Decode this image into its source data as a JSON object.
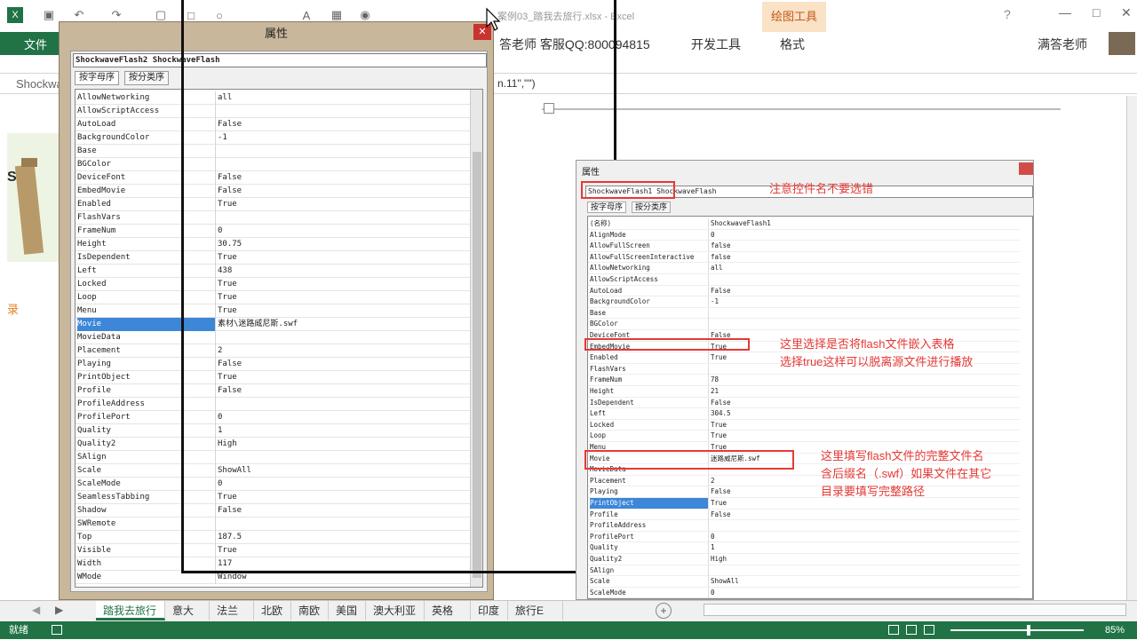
{
  "window": {
    "title": "案例03_踏我去旅行.xlsx - Excel",
    "user": "满答老师",
    "draw_tools": "绘图工具",
    "help": "?"
  },
  "ribbon": {
    "file_tab": "文件",
    "qq_label": "答老师 客服QQ:800094815",
    "dev_tab": "开发工具",
    "format_tab": "格式"
  },
  "formula_bar": {
    "name_box": "Shockwa",
    "formula_text": "n.11\",\"\")"
  },
  "sheet_left_note": "录",
  "dialog_left": {
    "title": "属性",
    "combo": "ShockwaveFlash2 ShockwaveFlash",
    "tab_alpha": "按字母序",
    "tab_cat": "按分类序",
    "rows": [
      {
        "name": "AllowNetworking",
        "value": "all"
      },
      {
        "name": "AllowScriptAccess",
        "value": ""
      },
      {
        "name": "AutoLoad",
        "value": "False"
      },
      {
        "name": "BackgroundColor",
        "value": "-1"
      },
      {
        "name": "Base",
        "value": ""
      },
      {
        "name": "BGColor",
        "value": ""
      },
      {
        "name": "DeviceFont",
        "value": "False"
      },
      {
        "name": "EmbedMovie",
        "value": "False"
      },
      {
        "name": "Enabled",
        "value": "True"
      },
      {
        "name": "FlashVars",
        "value": ""
      },
      {
        "name": "FrameNum",
        "value": "0"
      },
      {
        "name": "Height",
        "value": "30.75"
      },
      {
        "name": "IsDependent",
        "value": "True"
      },
      {
        "name": "Left",
        "value": "438"
      },
      {
        "name": "Locked",
        "value": "True"
      },
      {
        "name": "Loop",
        "value": "True"
      },
      {
        "name": "Menu",
        "value": "True"
      },
      {
        "name": "Movie",
        "value": "素材\\迷路威尼斯.swf"
      },
      {
        "name": "MovieData",
        "value": ""
      },
      {
        "name": "Placement",
        "value": "2"
      },
      {
        "name": "Playing",
        "value": "False"
      },
      {
        "name": "PrintObject",
        "value": "True"
      },
      {
        "name": "Profile",
        "value": "False"
      },
      {
        "name": "ProfileAddress",
        "value": ""
      },
      {
        "name": "ProfilePort",
        "value": "0"
      },
      {
        "name": "Quality",
        "value": "1"
      },
      {
        "name": "Quality2",
        "value": "High"
      },
      {
        "name": "SAlign",
        "value": ""
      },
      {
        "name": "Scale",
        "value": "ShowAll"
      },
      {
        "name": "ScaleMode",
        "value": "0"
      },
      {
        "name": "SeamlessTabbing",
        "value": "True"
      },
      {
        "name": "Shadow",
        "value": "False"
      },
      {
        "name": "SWRemote",
        "value": ""
      },
      {
        "name": "Top",
        "value": "187.5"
      },
      {
        "name": "Visible",
        "value": "True"
      },
      {
        "name": "Width",
        "value": "117"
      },
      {
        "name": "WMode",
        "value": "Window"
      }
    ]
  },
  "dialog_right": {
    "title": "属性",
    "combo": "ShockwaveFlash1 ShockwaveFlash",
    "tab_alpha": "按字母序",
    "tab_cat": "按分类序",
    "rows": [
      {
        "name": "(名称)",
        "value": "ShockwaveFlash1"
      },
      {
        "name": "AlignMode",
        "value": "0"
      },
      {
        "name": "AllowFullScreen",
        "value": "false"
      },
      {
        "name": "AllowFullScreenInteractive",
        "value": "false"
      },
      {
        "name": "AllowNetworking",
        "value": "all"
      },
      {
        "name": "AllowScriptAccess",
        "value": ""
      },
      {
        "name": "AutoLoad",
        "value": "False"
      },
      {
        "name": "BackgroundColor",
        "value": "-1"
      },
      {
        "name": "Base",
        "value": ""
      },
      {
        "name": "BGColor",
        "value": ""
      },
      {
        "name": "DeviceFont",
        "value": "False"
      },
      {
        "name": "EmbedMovie",
        "value": "True"
      },
      {
        "name": "Enabled",
        "value": "True"
      },
      {
        "name": "FlashVars",
        "value": ""
      },
      {
        "name": "FrameNum",
        "value": "78"
      },
      {
        "name": "Height",
        "value": "21"
      },
      {
        "name": "IsDependent",
        "value": "False"
      },
      {
        "name": "Left",
        "value": "304.5"
      },
      {
        "name": "Locked",
        "value": "True"
      },
      {
        "name": "Loop",
        "value": "True"
      },
      {
        "name": "Menu",
        "value": "True"
      },
      {
        "name": "Movie",
        "value": "迷路威尼斯.swf"
      },
      {
        "name": "MovieData",
        "value": ""
      },
      {
        "name": "Placement",
        "value": "2"
      },
      {
        "name": "Playing",
        "value": "False"
      },
      {
        "name": "PrintObject",
        "value": "True"
      },
      {
        "name": "Profile",
        "value": "False"
      },
      {
        "name": "ProfileAddress",
        "value": ""
      },
      {
        "name": "ProfilePort",
        "value": "0"
      },
      {
        "name": "Quality",
        "value": "1"
      },
      {
        "name": "Quality2",
        "value": "High"
      },
      {
        "name": "SAlign",
        "value": ""
      },
      {
        "name": "Scale",
        "value": "ShowAll"
      },
      {
        "name": "ScaleMode",
        "value": "0"
      }
    ]
  },
  "notes": {
    "note1": "注意控件名不要选错",
    "note2a": "这里选择是否将flash文件嵌入表格",
    "note2b": "选择true这样可以脱离源文件进行播放",
    "note3a": "这里填写flash文件的完整文件名",
    "note3b": "含后缀名（.swf）如果文件在其它",
    "note3c": "目录要填写完整路径"
  },
  "sheet_tabs": [
    "踏我去旅行",
    "意大利",
    "法兰西",
    "北欧",
    "南欧",
    "美国",
    "澳大利亚",
    "英格兰",
    "印度",
    "旅行E ..."
  ],
  "status": {
    "ready": "就绪",
    "zoom": "85%"
  },
  "colors": {
    "excel_green": "#217346",
    "annotation_red": "#e53935"
  }
}
